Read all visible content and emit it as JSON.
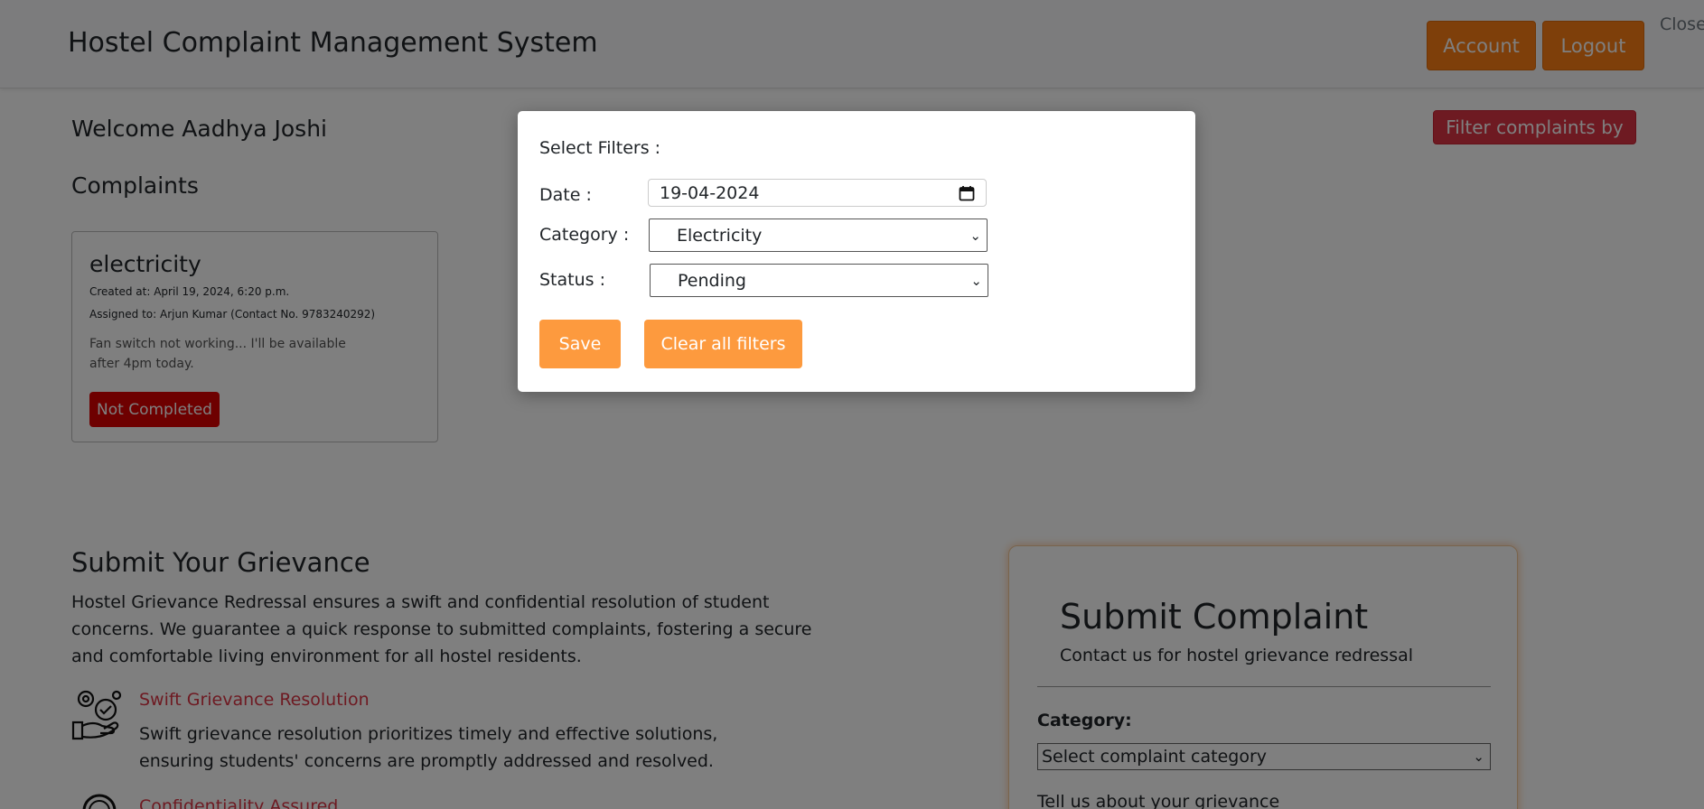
{
  "header": {
    "brand": "Hostel Complaint Management System",
    "account_label": "Account",
    "logout_label": "Logout",
    "close_label": "Close"
  },
  "main": {
    "welcome": "Welcome Aadhya Joshi",
    "complaints_heading": "Complaints",
    "filter_button": "Filter complaints by"
  },
  "complaint_card": {
    "title": "electricity",
    "created": "Created at: April 19, 2024, 6:20 p.m.",
    "assigned": "Assigned to: Arjun Kumar (Contact No. 9783240292)",
    "description": "Fan switch not working... I'll be available after 4pm today.",
    "status_badge": "Not Completed"
  },
  "grievance": {
    "title": "Submit Your Grievance",
    "text": "Hostel Grievance Redressal ensures a swift and confidential resolution of student concerns. We guarantee a quick response to submitted complaints, fostering a secure and comfortable living environment for all hostel residents.",
    "feature1_title": "Swift Grievance Resolution",
    "feature1_text": "Swift grievance resolution prioritizes timely and effective solutions, ensuring students' concerns are promptly addressed and resolved.",
    "feature2_title": "Confidentiality Assured"
  },
  "submit_form": {
    "title": "Submit Complaint",
    "subtitle": "Contact us for hostel grievance redressal",
    "category_label": "Category:",
    "category_value": "Select complaint category",
    "tell_label": "Tell us about your grievance"
  },
  "modal": {
    "title": "Select Filters :",
    "date_label": "Date :",
    "date_value": "19-04-2024",
    "category_label": "Category :",
    "category_value": "Electricity",
    "status_label": "Status :",
    "status_value": "Pending",
    "save_label": "Save",
    "clear_label": "Clear all filters"
  },
  "colors": {
    "accent": "#fd7e14",
    "danger": "#dc3545",
    "badge": "#dc0000",
    "modal_button": "#fd9a3e"
  }
}
